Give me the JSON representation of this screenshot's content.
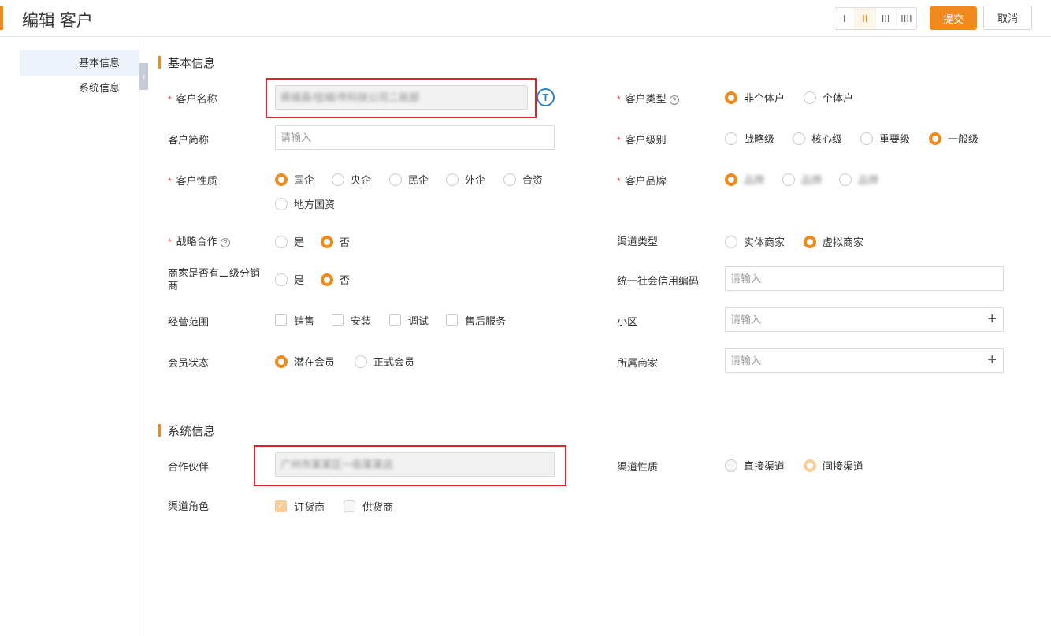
{
  "header": {
    "title": "编辑 客户",
    "column_options": [
      "I",
      "II",
      "III",
      "IIII"
    ],
    "column_selected": "II",
    "submit_label": "提交",
    "cancel_label": "取消"
  },
  "sidebar": {
    "items": [
      {
        "label": "基本信息",
        "active": true
      },
      {
        "label": "系统信息",
        "active": false
      }
    ],
    "collapse_icon": "chevron-left-icon"
  },
  "basic_section": {
    "title": "基本信息",
    "customer_name": {
      "label": "客户名称",
      "value": "商城县/信城/市科技公司二批部",
      "ocr_icon": "ocr-text-icon",
      "ocr_glyph": "T"
    },
    "customer_type": {
      "label": "客户类型",
      "options": [
        "非个体户",
        "个体户"
      ],
      "selected": "非个体户"
    },
    "customer_abbr": {
      "label": "客户简称",
      "placeholder": "请输入"
    },
    "customer_level": {
      "label": "客户级别",
      "options": [
        "战略级",
        "核心级",
        "重要级",
        "一般级"
      ],
      "selected": "一般级"
    },
    "customer_nature": {
      "label": "客户性质",
      "options": [
        "国企",
        "央企",
        "民企",
        "外企",
        "合资",
        "地方国资"
      ],
      "selected": "国企"
    },
    "customer_brand": {
      "label": "客户品牌",
      "options": [
        "品牌",
        "品牌",
        "品牌"
      ],
      "selected_index": 0
    },
    "strategic": {
      "label": "战略合作",
      "options": [
        "是",
        "否"
      ],
      "selected": "否"
    },
    "channel_type": {
      "label": "渠道类型",
      "options": [
        "实体商家",
        "虚拟商家"
      ],
      "selected": "虚拟商家"
    },
    "secondary_dist": {
      "label_line1": "商家是否有二级分销",
      "label_line2": "商",
      "options": [
        "是",
        "否"
      ],
      "selected": "否"
    },
    "credit_code": {
      "label": "统一社会信用编码",
      "placeholder": "请输入"
    },
    "business_scope": {
      "label": "经营范围",
      "options": [
        "销售",
        "安装",
        "调试",
        "售后服务"
      ]
    },
    "community": {
      "label": "小区",
      "placeholder": "请输入"
    },
    "member_status": {
      "label": "会员状态",
      "options": [
        "潜在会员",
        "正式会员"
      ],
      "selected": "潜在会员"
    },
    "merchant": {
      "label": "所属商家",
      "placeholder": "请输入"
    }
  },
  "system_section": {
    "title": "系统信息",
    "partner": {
      "label": "合作伙伴",
      "value": "广州市某某区一街某某店"
    },
    "channel_nature": {
      "label": "渠道性质",
      "options": [
        "直接渠道",
        "间接渠道"
      ],
      "selected": "间接渠道"
    },
    "channel_role": {
      "label": "渠道角色",
      "options": [
        "订货商",
        "供货商"
      ],
      "checked": "订货商"
    }
  },
  "colors": {
    "accent": "#f08a1d",
    "required": "#e64545",
    "highlight_box": "#d9262c",
    "ocr_blue": "#2d7fd3"
  }
}
